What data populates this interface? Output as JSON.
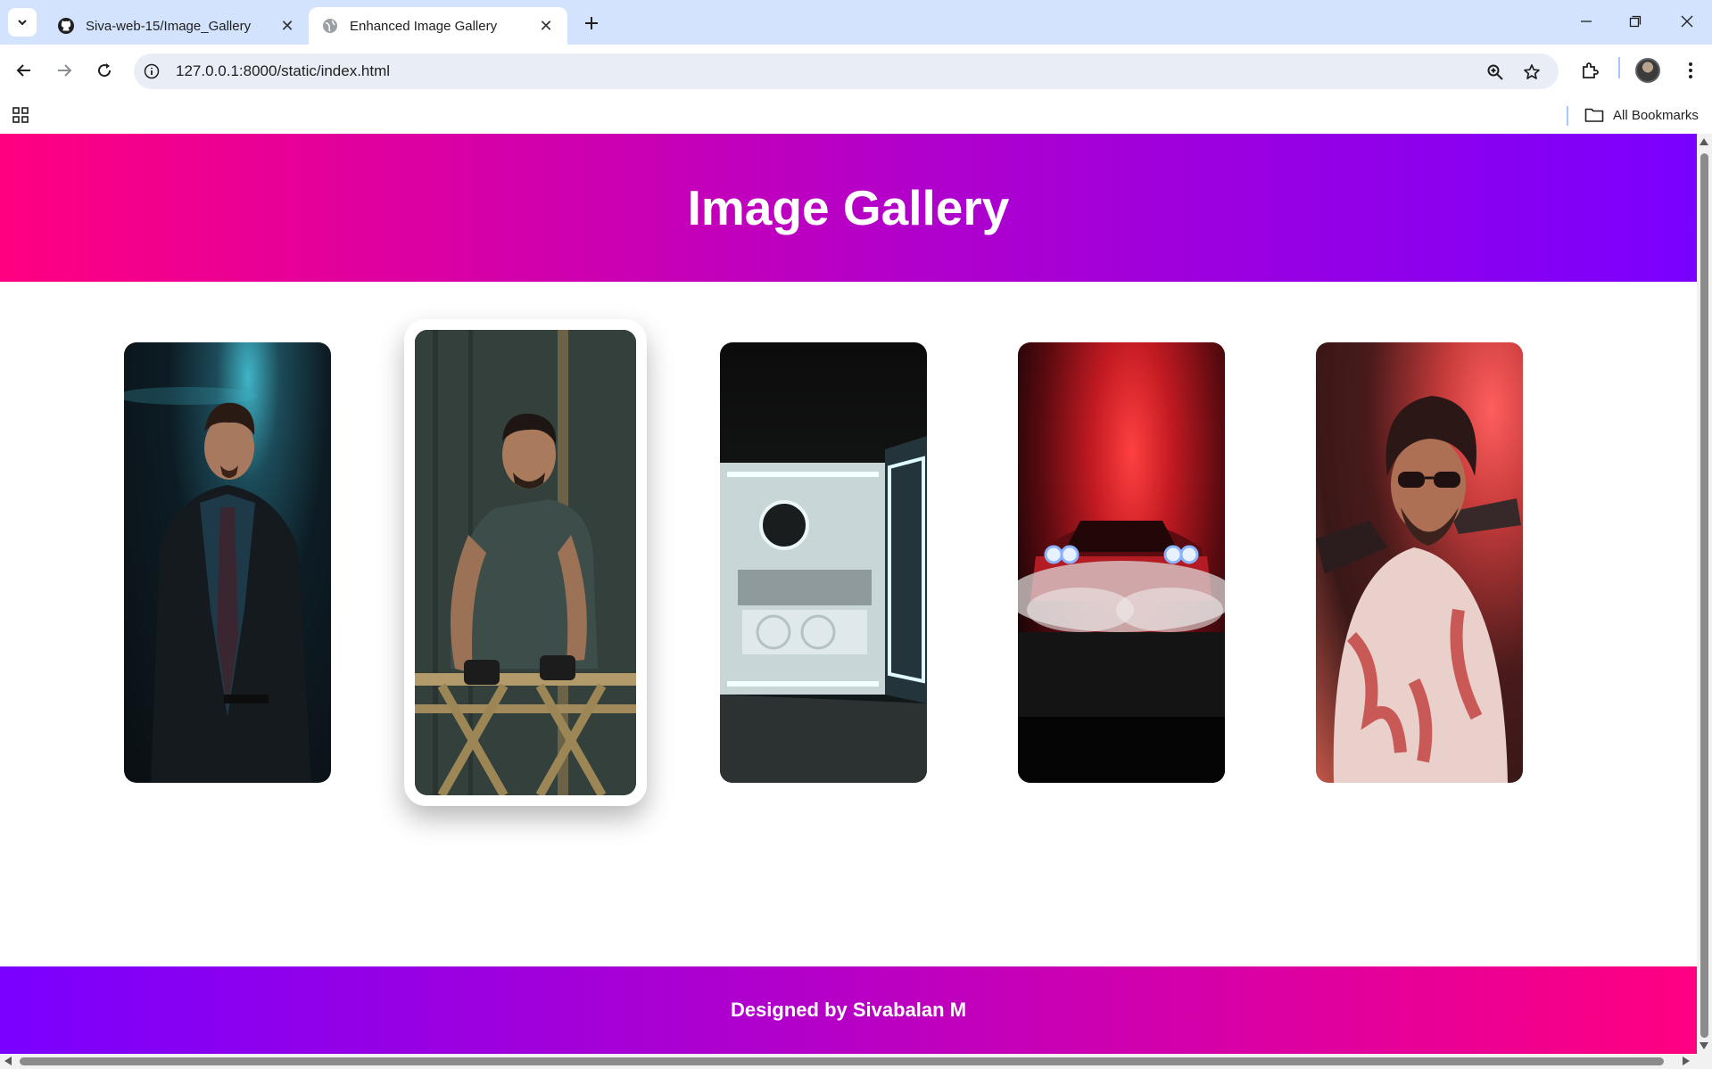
{
  "browser": {
    "tabs": [
      {
        "title": "Siva-web-15/Image_Gallery",
        "icon": "github-icon",
        "active": false
      },
      {
        "title": "Enhanced Image Gallery",
        "icon": "globe-icon",
        "active": true
      }
    ],
    "address_bar": {
      "url": "127.0.0.1:8000/static/index.html"
    },
    "bookmarks": {
      "all_bookmarks_label": "All Bookmarks"
    }
  },
  "page": {
    "header_title": "Image Gallery",
    "footer_text": "Designed by Sivabalan M",
    "gallery": [
      {
        "name": "gallery-image-man-in-suit",
        "hovered": false
      },
      {
        "name": "gallery-image-man-leaning-on-fence",
        "hovered": true
      },
      {
        "name": "gallery-image-gaming-pc",
        "hovered": false
      },
      {
        "name": "gallery-image-red-muscle-car",
        "hovered": false
      },
      {
        "name": "gallery-image-man-with-sunglasses",
        "hovered": false
      }
    ]
  },
  "colors": {
    "header_gradient": [
      "#ff0080",
      "#b000cc",
      "#7a00ff"
    ],
    "footer_gradient": [
      "#7a00ff",
      "#b000cc",
      "#ff0080"
    ],
    "tabstrip_bg": "#d3e3fd"
  }
}
